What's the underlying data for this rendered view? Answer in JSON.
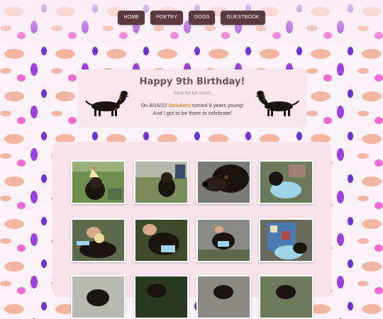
{
  "nav": {
    "items": [
      "HOME",
      "POETRY",
      "DOGS",
      "GUESTBOOK"
    ]
  },
  "header": {
    "title": "Happy 9th Birthday!",
    "subtitle": "(click for full sizes)",
    "line1_prefix": "On 6/16/22 ",
    "line1_name": "Snickers",
    "line1_suffix": " turned 9 years young!",
    "line2": "And I got to be there to celebrate!"
  },
  "colors": {
    "nav_bg": "#5a3a3e",
    "card_bg": "#fbe6ee",
    "gallery_bg": "#f9e2ea",
    "name_accent": "#e08a2a"
  },
  "gallery": {
    "photos": [
      {
        "icon": "photo-dog-party-hat"
      },
      {
        "icon": "photo-dog-on-grass"
      },
      {
        "icon": "photo-dog-closeup"
      },
      {
        "icon": "photo-dog-blue-shirt"
      },
      {
        "icon": "photo-dog-hands"
      },
      {
        "icon": "photo-dog-petting"
      },
      {
        "icon": "photo-dog-pavement"
      },
      {
        "icon": "photo-person-with-dog"
      },
      {
        "icon": "photo-dog-1"
      },
      {
        "icon": "photo-dog-2"
      },
      {
        "icon": "photo-dog-3"
      },
      {
        "icon": "photo-dog-4"
      }
    ]
  }
}
